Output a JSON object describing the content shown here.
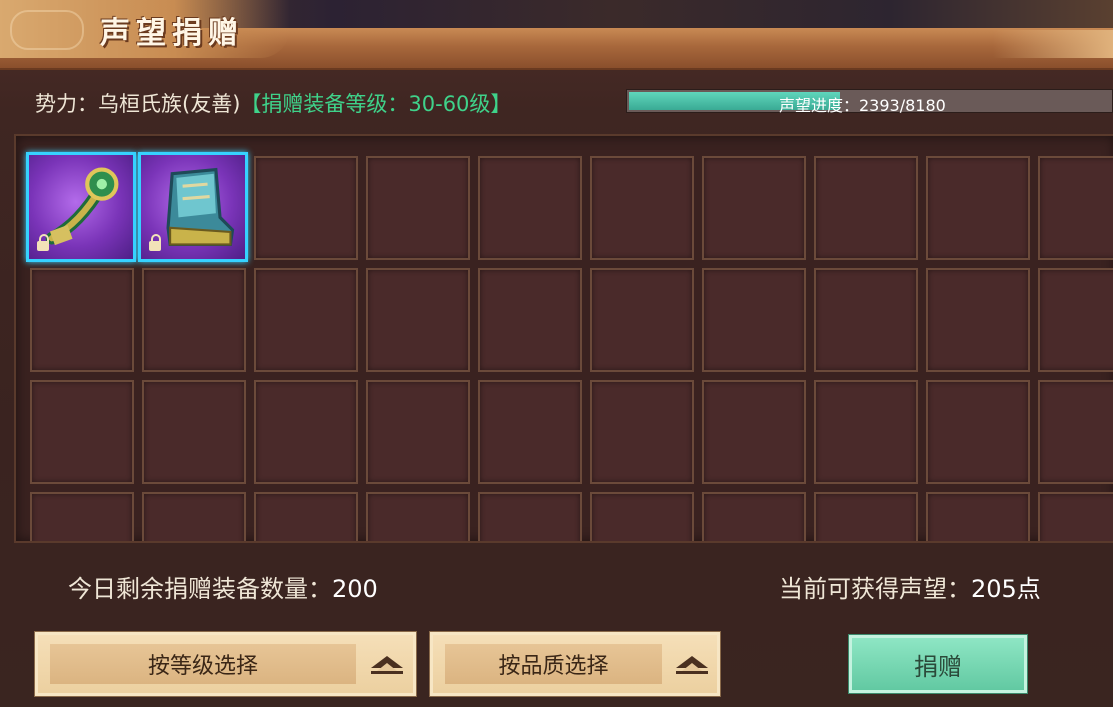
{
  "title": "声望捐赠",
  "faction": {
    "label": "势力：乌桓氏族(友善)",
    "level_range": "【捐赠装备等级：30-60级】"
  },
  "reputation": {
    "label": "声望进度：2393/8180",
    "current": 2393,
    "max": 8180
  },
  "inventory": {
    "items": [
      {
        "icon": "jade-wand-icon",
        "locked": true,
        "quality_color": "#7a34b8"
      },
      {
        "icon": "boots-icon",
        "locked": true,
        "quality_color": "#7a34b8"
      }
    ]
  },
  "summary": {
    "remaining_label": "今日剩余捐赠装备数量：",
    "remaining_value": "200",
    "gain_label": "当前可获得声望：",
    "gain_value": "205点"
  },
  "buttons": {
    "select_by_level": "按等级选择",
    "select_by_quality": "按品质选择",
    "donate": "捐赠"
  },
  "colors": {
    "accent_green": "#3fd28a",
    "progress_fill": "#4fc2a8",
    "item_border": "#36d2ff",
    "donate_button": "#7ad8b4"
  }
}
